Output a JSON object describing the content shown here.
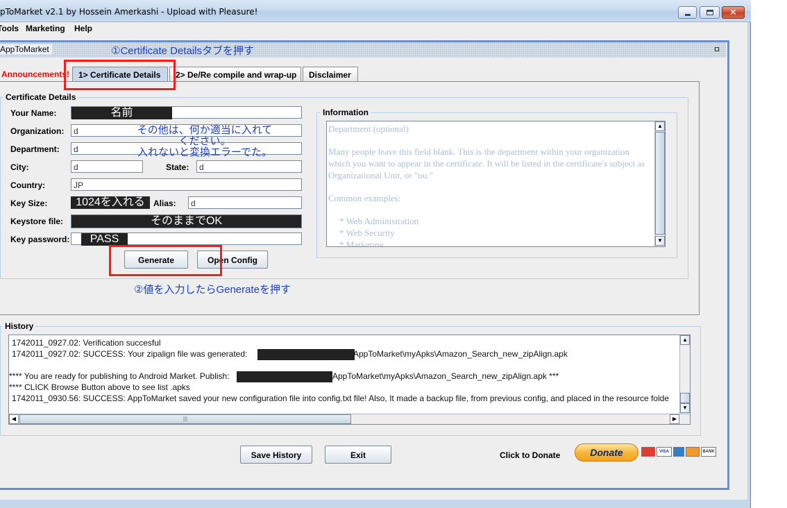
{
  "window": {
    "title": "pToMarket v2.1 by Hossein Amerkashi - Upload with Pleasure!"
  },
  "menu": {
    "tools": "Tools",
    "marketing": "Marketing",
    "help": "Help"
  },
  "internal_frame": {
    "title": "AppToMarket",
    "restore_glyph": "ㅁ"
  },
  "tabs": [
    {
      "label": "Announcements!"
    },
    {
      "label": "1> Certificate Details"
    },
    {
      "label": "2> De/Re compile and wrap-up"
    },
    {
      "label": "Disclaimer"
    }
  ],
  "certificate": {
    "group_label": "Certificate Details",
    "your_name_label": "Your Name:",
    "your_name_value": "名前",
    "organization_label": "Organization:",
    "organization_value": "d",
    "department_label": "Department:",
    "department_value": "d",
    "city_label": "City:",
    "city_value": "d",
    "state_label": "State:",
    "state_value": "d",
    "country_label": "Country:",
    "country_value": "JP",
    "key_size_label": "Key Size:",
    "key_size_value": "1024を入れる",
    "alias_label": "Alias:",
    "alias_value": "d",
    "keystore_label": "Keystore file:",
    "keystore_value": "そのままでOK",
    "key_password_label": "Key password:",
    "key_password_value": "PASS",
    "generate_button": "Generate",
    "open_config_button": "Open Config"
  },
  "information": {
    "group_label": "Information",
    "heading": "Department (optional)",
    "para1": "Many people leave this field blank. This is the department within your organization which you want to appear in the certificate. It will be listed in the certificate's subject as Organizational Unit, or \"ou.\"",
    "examples_title": "Common examples:",
    "examples": [
      "* Web Administration",
      "* Web Security",
      "* Marketing"
    ]
  },
  "annotations": {
    "step1": "①Certificate Detailsタブを押す",
    "others": "その他は、何か適当に入れて\nください。\n入れないと変換エラーでた。",
    "step2": "②値を入力したらGenerateを押す"
  },
  "history": {
    "group_label": "History",
    "lines": [
      "1742011_0927.02:  Verification succesful",
      "1742011_0927.02:  SUCCESS: Your zipalign file was generated: ",
      "AppToMarket\\myApks\\Amazon_Search_new_zipAlign.apk",
      "**** You are ready for publishing to Android Market. Publish: ",
      "AppToMarket\\myApks\\Amazon_Search_new_zipAlign.apk ***",
      "**** CLICK Browse Button above to see list .apks",
      "1742011_0930.56:  SUCCESS: AppToMarket saved your new configuration file into config.txt file! Also, It made a backup file, from previous config, and placed in the resource folde"
    ]
  },
  "footer": {
    "save_history": "Save History",
    "exit": "Exit",
    "click_to_donate": "Click to Donate",
    "donate": "Donate",
    "cards": [
      "VISA",
      "BANK"
    ]
  },
  "colors": {
    "annotation_blue": "#1a3fc6",
    "highlight_red": "#ff1a1a",
    "frame_blue": "#6d8fc9"
  }
}
